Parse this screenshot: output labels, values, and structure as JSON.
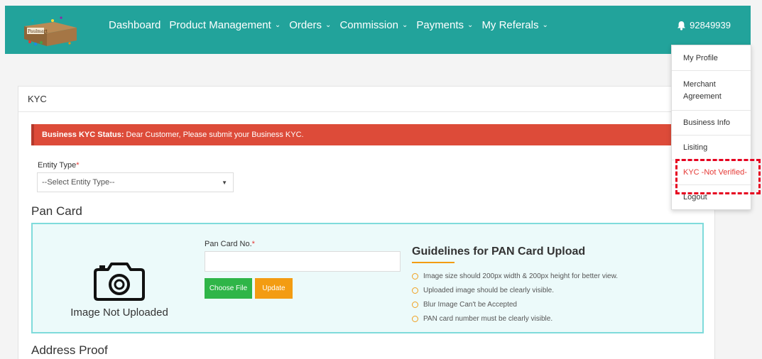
{
  "navbar": {
    "logo_text": "Paulmart",
    "items": [
      {
        "label": "Dashboard",
        "has_dropdown": false
      },
      {
        "label": "Product Management",
        "has_dropdown": true
      },
      {
        "label": "Orders",
        "has_dropdown": true
      },
      {
        "label": "Commission",
        "has_dropdown": true
      },
      {
        "label": "Payments",
        "has_dropdown": true
      },
      {
        "label": "My Referals",
        "has_dropdown": true
      }
    ],
    "user_id": "92849939",
    "icon": "bell-icon",
    "color": "#22a39b"
  },
  "dropdown": {
    "items": [
      {
        "label": "My Profile"
      },
      {
        "label": "Merchant Agreement"
      },
      {
        "label": "Business Info"
      },
      {
        "label": "Lisiting"
      },
      {
        "label": "KYC -Not Verified-"
      },
      {
        "label": "Logout"
      }
    ]
  },
  "panel": {
    "title": "KYC",
    "alert": {
      "bold": "Business KYC Status:",
      "text": "Dear Customer, Please submit your Business KYC.",
      "color": "#dd4b39"
    },
    "entity": {
      "label": "Entity Type",
      "required_mark": "*",
      "selected": "--Select Entity Type--"
    },
    "pan_section": {
      "heading": "Pan Card",
      "image_caption": "Image Not Uploaded",
      "image_icon": "camera-icon",
      "field_label": "Pan Card No.",
      "required_mark": "*",
      "value": "",
      "choose_file_label": "Choose File",
      "update_label": "Update",
      "guidelines_title": "Guidelines for PAN Card Upload",
      "guidelines": [
        "Image size should 200px width & 200px height for better view.",
        "Uploaded image should be clearly visible.",
        "Blur Image Can't be Accepted",
        "PAN card number must be clearly visible."
      ]
    },
    "address_heading": "Address Proof"
  }
}
